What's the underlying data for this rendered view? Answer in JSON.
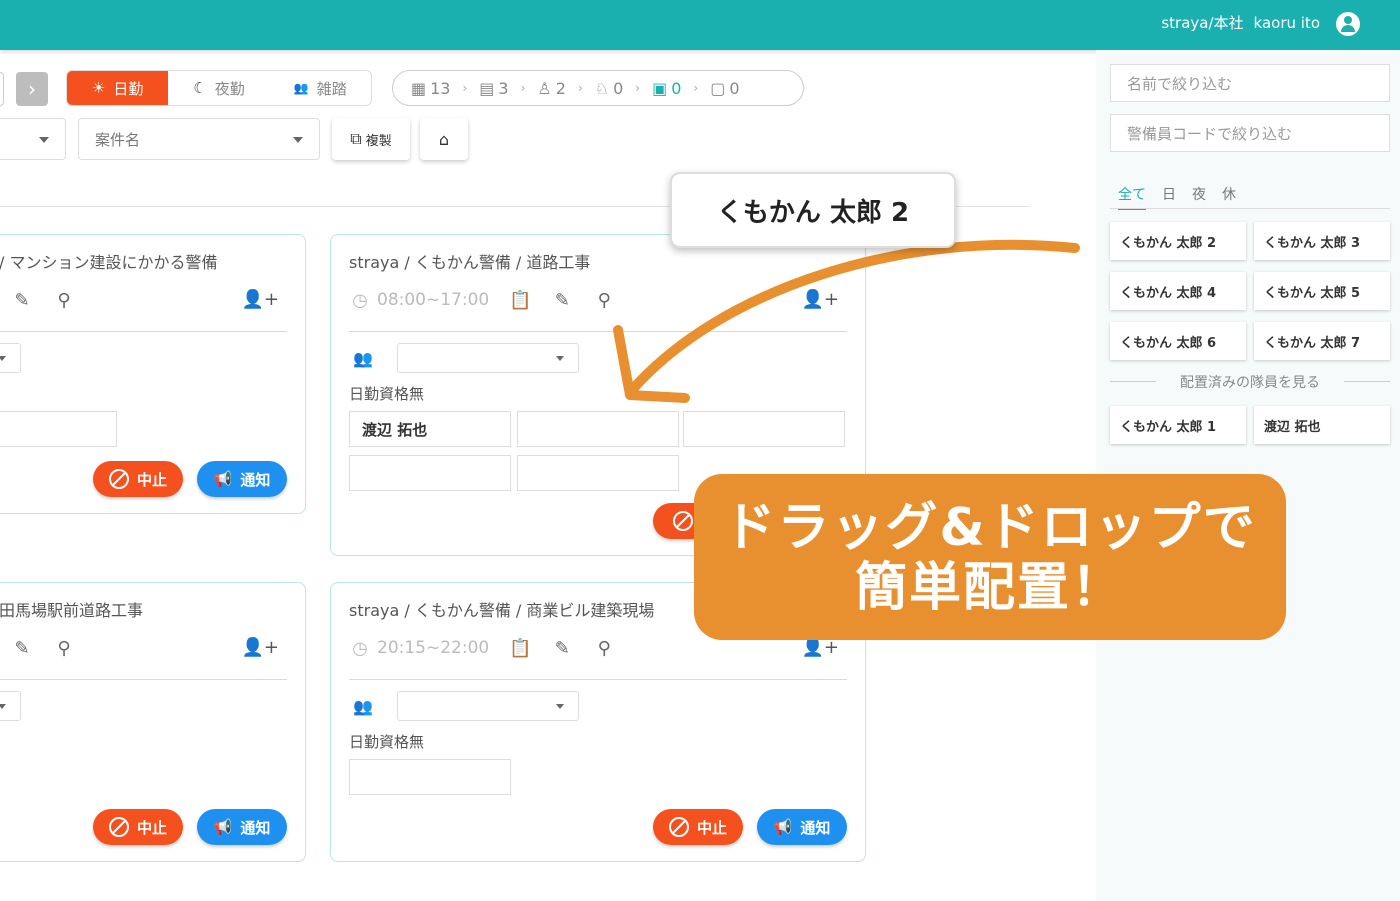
{
  "header": {
    "org": "straya/本社",
    "user": "kaoru ito"
  },
  "shift_tabs": [
    {
      "label": "日勤",
      "icon": "sun-icon"
    },
    {
      "label": "夜勤",
      "icon": "moon-icon"
    },
    {
      "label": "雑踏",
      "icon": "crowd-icon"
    }
  ],
  "status_counts": [
    {
      "value": "13",
      "icon": "building-icon"
    },
    {
      "value": "3",
      "icon": "document-icon"
    },
    {
      "value": "2",
      "icon": "worker-icon"
    },
    {
      "value": "0",
      "icon": "running-icon"
    },
    {
      "value": "0",
      "icon": "badge-icon"
    },
    {
      "value": "0",
      "icon": "id-card-icon"
    }
  ],
  "toolbar": {
    "project_select": "案件名",
    "copy_label": "複製"
  },
  "cards": [
    {
      "title": "/ マンション建設にかかる警備"
    },
    {
      "title": "straya / くもかん警備 / 道路工事",
      "time": "08:00~17:00",
      "label": "日勤資格無",
      "assigned": "渡辺 拓也"
    },
    {
      "title": "田馬場駅前道路工事"
    },
    {
      "title": "straya / くもかん警備 / 商業ビル建築現場",
      "time": "20:15~22:00",
      "label": "日勤資格無"
    }
  ],
  "buttons": {
    "stop": "中止",
    "notify": "通知"
  },
  "sidebar": {
    "filter_name": "名前で絞り込む",
    "filter_code": "警備員コードで絞り込む",
    "tabs": [
      "全て",
      "日",
      "夜",
      "休"
    ],
    "guards": [
      "くもかん 太郎 2",
      "くもかん 太郎 3",
      "くもかん 太郎 4",
      "くもかん 太郎 5",
      "くもかん 太郎 6",
      "くもかん 太郎 7"
    ],
    "assigned_label": "配置済みの隊員を見る",
    "assigned": [
      "くもかん 太郎 1",
      "渡辺 拓也"
    ]
  },
  "drag_chip": "くもかん 太郎 2",
  "banner": {
    "line1": "ドラッグ&ドロップで",
    "line2": "簡単配置！"
  },
  "colors": {
    "brand": "#1bb0b0",
    "stop": "#f4511e",
    "notify": "#1e90f0",
    "banner": "#e8902f"
  }
}
